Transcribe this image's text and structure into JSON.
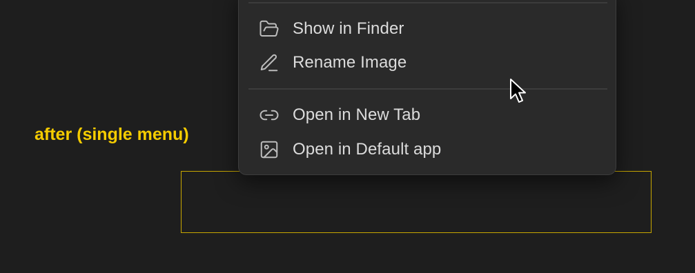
{
  "annotation": {
    "label": "after (single menu)",
    "label_color": "#f5cc00",
    "box_color": "#c9a800"
  },
  "context_menu": {
    "groups": [
      {
        "items": [
          {
            "label": "Show in Finder",
            "icon": "folder-open-icon"
          },
          {
            "label": "Rename Image",
            "icon": "pencil-icon"
          }
        ]
      },
      {
        "items": [
          {
            "label": "Open in New Tab",
            "icon": "link-icon"
          },
          {
            "label": "Open in Default app",
            "icon": "image-icon"
          }
        ]
      }
    ]
  },
  "pointer": {
    "icon": "mouse-pointer-icon"
  },
  "colors": {
    "background": "#1e1e1e",
    "menu_background": "#2a2a2a",
    "menu_text": "#dcdcdc",
    "separator": "#3c3c3c"
  }
}
